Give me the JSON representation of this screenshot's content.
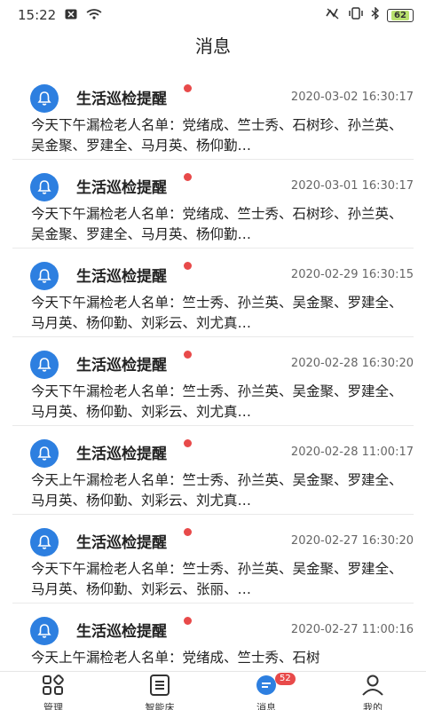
{
  "status": {
    "time": "15:22",
    "battery": "62"
  },
  "page": {
    "title": "消息"
  },
  "messages": [
    {
      "title": "生活巡检提醒",
      "time": "2020-03-02 16:30:17",
      "body": "今天下午漏检老人名单：党绪成、竺士秀、石树珍、孙兰英、吴金聚、罗建全、马月英、杨仰勤…"
    },
    {
      "title": "生活巡检提醒",
      "time": "2020-03-01 16:30:17",
      "body": "今天下午漏检老人名单：党绪成、竺士秀、石树珍、孙兰英、吴金聚、罗建全、马月英、杨仰勤…"
    },
    {
      "title": "生活巡检提醒",
      "time": "2020-02-29 16:30:15",
      "body": "今天下午漏检老人名单：竺士秀、孙兰英、吴金聚、罗建全、马月英、杨仰勤、刘彩云、刘尤真…"
    },
    {
      "title": "生活巡检提醒",
      "time": "2020-02-28 16:30:20",
      "body": "今天下午漏检老人名单：竺士秀、孙兰英、吴金聚、罗建全、马月英、杨仰勤、刘彩云、刘尤真…"
    },
    {
      "title": "生活巡检提醒",
      "time": "2020-02-28 11:00:17",
      "body": "今天上午漏检老人名单：竺士秀、孙兰英、吴金聚、罗建全、马月英、杨仰勤、刘彩云、刘尤真…"
    },
    {
      "title": "生活巡检提醒",
      "time": "2020-02-27 16:30:20",
      "body": "今天下午漏检老人名单：竺士秀、孙兰英、吴金聚、罗建全、马月英、杨仰勤、刘彩云、张丽、…"
    },
    {
      "title": "生活巡检提醒",
      "time": "2020-02-27 11:00:16",
      "body": "今天上午漏检老人名单：党绪成、竺士秀、石树"
    }
  ],
  "tabs": [
    {
      "label": "管理",
      "icon": "grid-icon"
    },
    {
      "label": "智能床",
      "icon": "clipboard-icon"
    },
    {
      "label": "消息",
      "icon": "message-icon",
      "badge": "52"
    },
    {
      "label": "我的",
      "icon": "person-icon"
    }
  ],
  "colors": {
    "accent": "#2d7fe0",
    "badge": "#e84a4a"
  }
}
